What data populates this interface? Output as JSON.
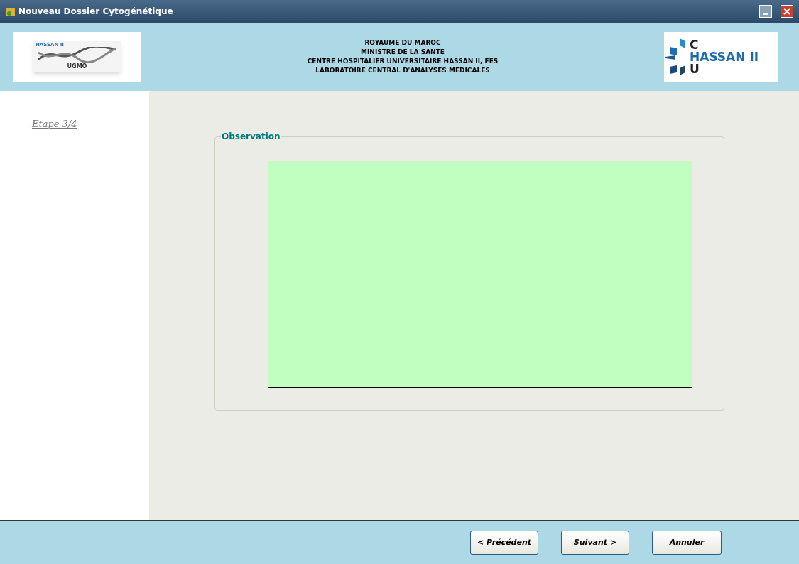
{
  "window": {
    "title": "Nouveau Dossier Cytogénétique"
  },
  "header": {
    "left_logo": {
      "small_text": "HASSAN II",
      "text": "UGMO"
    },
    "lines": [
      "ROYAUME DU MAROC",
      "MINISTRE DE LA SANTE",
      "CENTRE HOSPITALIER UNIVERSITAIRE HASSAN II, FES",
      "LABORATOIRE CENTRAL D'ANALYSES MEDICALES"
    ],
    "right_logo": {
      "top": "C",
      "middle": "HASSAN II",
      "bottom": "U"
    }
  },
  "sidebar": {
    "step": "Etape 3/4"
  },
  "observation": {
    "legend": "Observation"
  },
  "buttons": [
    {
      "label": "< Précédent"
    },
    {
      "label": "Suivant >"
    },
    {
      "label": "Annuler"
    }
  ]
}
